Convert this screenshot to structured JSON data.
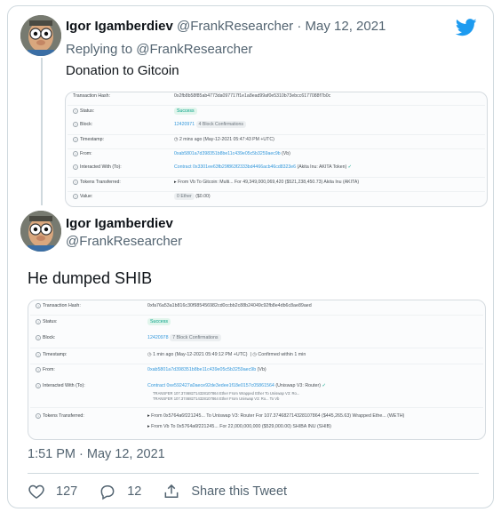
{
  "quoted_tweet": {
    "author_name": "Igor Igamberdiev",
    "author_handle": "@FrankResearcher",
    "separator": "·",
    "date": "May 12, 2021",
    "replying_prefix": "Replying to",
    "replying_handle": "@FrankResearcher",
    "text": "Donation to Gitcoin",
    "tx_card": {
      "rows": [
        {
          "label": "Transaction Hash:",
          "value": "0x2fb8b58f85ab4773da097717f1e1a8ead99af0e5310b73ebcc6177088f7b0c"
        },
        {
          "label": "Status:",
          "value": "Success"
        },
        {
          "label": "Block:",
          "value": "12420971",
          "extra": "4 Block Confirmations"
        },
        {
          "label": "Timestamp:",
          "value": "2 mins ago (May-12-2021 05:47:43 PM +UTC)"
        },
        {
          "label": "From:",
          "value": "0xab5801a7d398351b8be11c439e05c5b3259aec9b",
          "extra": "(Vb)"
        },
        {
          "label": "Interacted With (To):",
          "value": "Contract 0x3301ee63fb29f863f2333bd4466acb46cd8323e6",
          "extra": "(Akita Inu: AKITA Token)"
        },
        {
          "label": "Tokens Transferred:",
          "value": "From Vb To Gitcoin: Multi...",
          "extra": "For 49,349,000,069,420 ($521,238,450.73) Akita Inu (AKITA)"
        },
        {
          "label": "Value:",
          "value": "0 Ether",
          "extra": "($0.00)"
        }
      ]
    }
  },
  "main_tweet": {
    "author_name": "Igor Igamberdiev",
    "author_handle": "@FrankResearcher",
    "text": "He dumped SHIB",
    "timestamp": "1:51 PM · May 12, 2021",
    "tx_card": {
      "rows": [
        {
          "label": "Transaction Hash:",
          "value": "0xfa76a53a1b816c30f985456982cd0ccbb2c88b24049c92fb8e4db6c8ae89aed"
        },
        {
          "label": "Status:",
          "value": "Success"
        },
        {
          "label": "Block:",
          "value": "12420978",
          "extra": "7 Block Confirmations"
        },
        {
          "label": "Timestamp:",
          "value": "1 min ago (May-12-2021 05:49:12 PM +UTC)",
          "extra": "Confirmed within 1 min"
        },
        {
          "label": "From:",
          "value": "0xab5801a7d398351b8be11c439e05c5b3259aec9b",
          "extra": "(Vb)"
        },
        {
          "label": "Interacted With (To):",
          "value": "Contract 0xe592427a0aece92de3edee1f18e0157c05861564",
          "extra": "(Uniswap V3: Router)",
          "sub": [
            "TRANSFER  107.374682714328107864 Ether From Wrapped Ether To Uniswap V3: Ro...",
            "TRANSFER  107.374682714328107864 Ether From Uniswap V3: Ro... To Vb"
          ]
        },
        {
          "label": "Tokens Transferred:",
          "lines": [
            "From 0x5764a6f221245...  To Uniswap V3: Router  For 107.374682714328107864 ($445,265.63) Wrapped Ethe... (WETH)",
            "From Vb  To 0x5764a6f221245...  For 22,000,000,000 ($529,000.00) SHIBA INU (SHIB)"
          ]
        }
      ]
    }
  },
  "actions": {
    "like_count": "127",
    "reply_count": "12",
    "share_label": "Share this Tweet"
  },
  "colors": {
    "brand": "#1d9bf0",
    "muted": "#536471",
    "border": "#cfd9de"
  }
}
